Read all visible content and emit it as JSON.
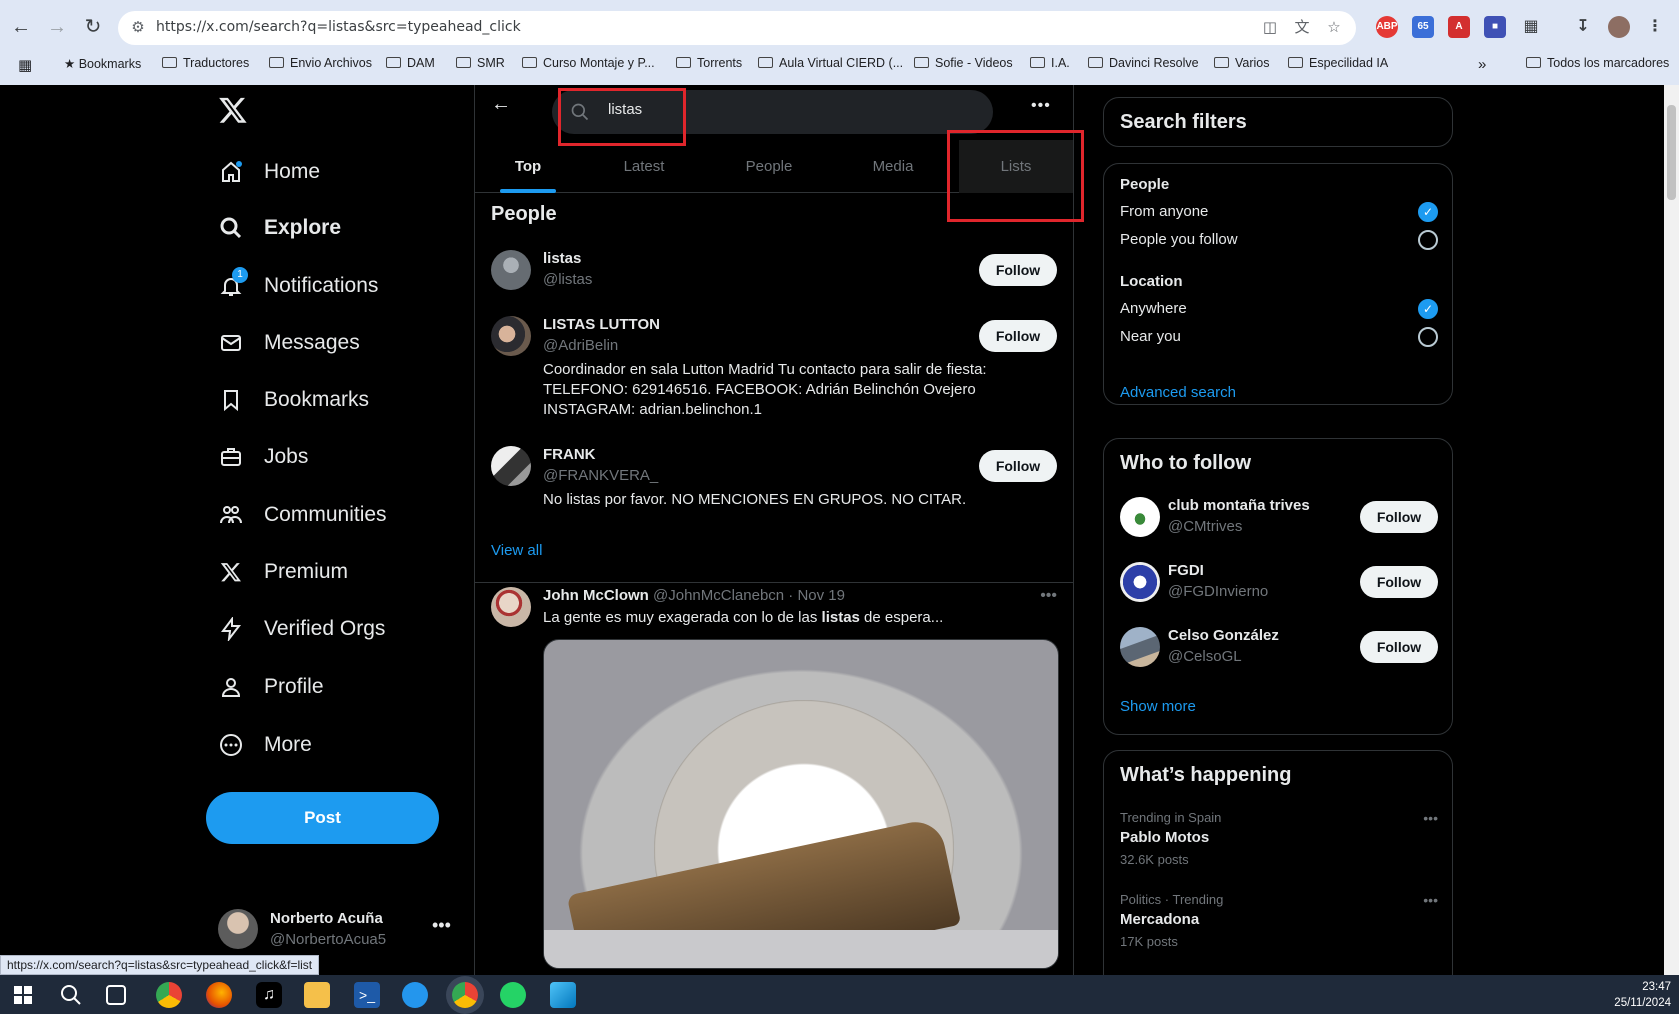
{
  "browser": {
    "url": "https://x.com/search?q=listas&src=typeahead_click",
    "bookmarks": [
      "Bookmarks",
      "Traductores",
      "Envio Archivos",
      "DAM",
      "SMR",
      "Curso Montaje y P...",
      "Torrents",
      "Aula Virtual CIERD (...",
      "Sofie - Videos",
      "I.A.",
      "Davinci Resolve",
      "Varios",
      "Especilidad IA"
    ],
    "all_bookmarks": "Todos los marcadores",
    "status_url": "https://x.com/search?q=listas&src=typeahead_click&f=list",
    "ext_badge": "65"
  },
  "nav": {
    "items": [
      "Home",
      "Explore",
      "Notifications",
      "Messages",
      "Bookmarks",
      "Jobs",
      "Communities",
      "Premium",
      "Verified Orgs",
      "Profile",
      "More"
    ],
    "notif_badge": "1",
    "post_label": "Post",
    "account_name": "Norberto Acuña",
    "account_handle": "@NorbertoAcua5"
  },
  "search": {
    "query": "listas",
    "tabs": [
      "Top",
      "Latest",
      "People",
      "Media",
      "Lists"
    ],
    "active_tab": "Top"
  },
  "people_section": {
    "title": "People",
    "people": [
      {
        "name": "listas",
        "handle": "@listas",
        "bio": "",
        "follow": "Follow"
      },
      {
        "name": "LISTAS LUTTON",
        "handle": "@AdriBelin",
        "bio": "Coordinador en sala Lutton Madrid Tu contacto para salir de fiesta: TELEFONO: 629146516. FACEBOOK: Adrián Belinchón Ovejero INSTAGRAM: adrian.belinchon.1",
        "follow": "Follow"
      },
      {
        "name": "FRANK",
        "handle": "@FRANKVERA_",
        "bio": "No listas por favor. NO MENCIONES EN GRUPOS. NO CITAR.",
        "follow": "Follow"
      }
    ],
    "view_all": "View all"
  },
  "tweet": {
    "name": "John McClown",
    "meta": "@JohnMcClanebcn · Nov 19",
    "text_before": "La gente es muy exagerada con lo de las ",
    "text_bold": "listas",
    "text_after": " de espera..."
  },
  "filters": {
    "title": "Search filters",
    "people_heading": "People",
    "people_options": [
      "From anyone",
      "People you follow"
    ],
    "location_heading": "Location",
    "location_options": [
      "Anywhere",
      "Near you"
    ],
    "advanced": "Advanced search"
  },
  "who_to_follow": {
    "title": "Who to follow",
    "accounts": [
      {
        "name": "club montaña trives",
        "handle": "@CMtrives",
        "follow": "Follow"
      },
      {
        "name": "FGDI",
        "handle": "@FGDInvierno",
        "follow": "Follow"
      },
      {
        "name": "Celso González",
        "handle": "@CelsoGL",
        "follow": "Follow"
      }
    ],
    "show_more": "Show more"
  },
  "whats_happening": {
    "title": "What’s happening",
    "trends": [
      {
        "context": "Trending in Spain",
        "name": "Pablo Motos",
        "posts": "32.6K posts"
      },
      {
        "context": "Politics · Trending",
        "name": "Mercadona",
        "posts": "17K posts"
      }
    ]
  },
  "taskbar": {
    "time": "23:47",
    "date": "25/11/2024"
  },
  "colors": {
    "accent": "#1d9bf0",
    "highlight_box": "#e0262c"
  }
}
